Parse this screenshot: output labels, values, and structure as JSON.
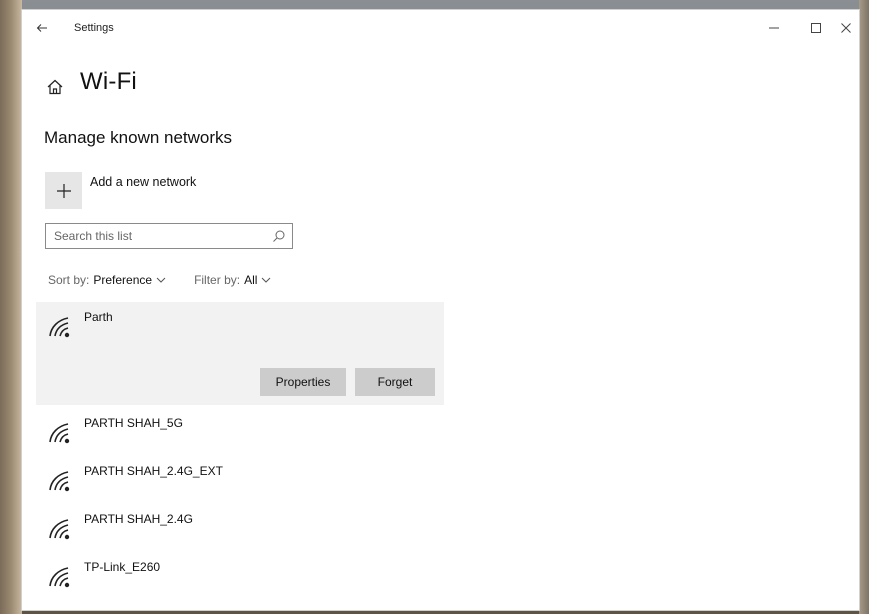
{
  "window": {
    "title": "Settings",
    "controls": [
      "minimize",
      "maximize",
      "close"
    ]
  },
  "page": {
    "title": "Wi-Fi",
    "section_title": "Manage known networks"
  },
  "add_network": {
    "label": "Add a new network"
  },
  "search": {
    "placeholder": "Search this list",
    "value": ""
  },
  "sort": {
    "label": "Sort by:",
    "value": "Preference"
  },
  "filter": {
    "label": "Filter by:",
    "value": "All"
  },
  "networks": [
    {
      "name": "Parth",
      "selected": true
    },
    {
      "name": "PARTH SHAH_5G"
    },
    {
      "name": "PARTH SHAH_2.4G_EXT"
    },
    {
      "name": "PARTH SHAH_2.4G"
    },
    {
      "name": "TP-Link_E260"
    }
  ],
  "selected_actions": {
    "properties_label": "Properties",
    "forget_label": "Forget"
  },
  "colors": {
    "selected_row_bg": "#f2f2f2",
    "button_bg": "#cccccc",
    "add_tile_bg": "#e6e6e6"
  }
}
